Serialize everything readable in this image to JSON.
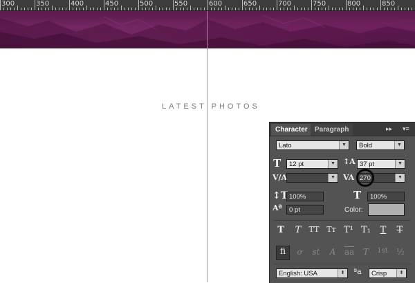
{
  "ruler": {
    "labels": [
      "300",
      "350",
      "400",
      "450",
      "500",
      "550",
      "600",
      "650",
      "700",
      "750",
      "800",
      "850"
    ]
  },
  "canvas": {
    "heading": "LATEST PHOTOS"
  },
  "character_panel": {
    "tabs": [
      "Character",
      "Paragraph"
    ],
    "menu_glyph": "▸▸",
    "font_family": "Lato",
    "font_style": "Bold",
    "font_size": "12 pt",
    "leading": "37 pt",
    "kerning": "",
    "tracking": "270",
    "vertical_scale": "100%",
    "horizontal_scale": "100%",
    "baseline_shift": "0 pt",
    "color_label": "Color:",
    "color_value": "#b0b0b0",
    "type_style_buttons": [
      "T",
      "T",
      "TT",
      "Tт",
      "T¹",
      "T₁",
      "T",
      "T"
    ],
    "opentype_buttons": [
      "ﬁ",
      "ơ",
      "st",
      "A",
      "aa",
      "T",
      "1st",
      "½"
    ],
    "language": "English: USA",
    "aa_glyph": "ªa",
    "antialias": "Crisp"
  },
  "colors": {
    "guide": "#27c9dc",
    "banner": "#6a2159",
    "panel_bg": "#535353"
  }
}
